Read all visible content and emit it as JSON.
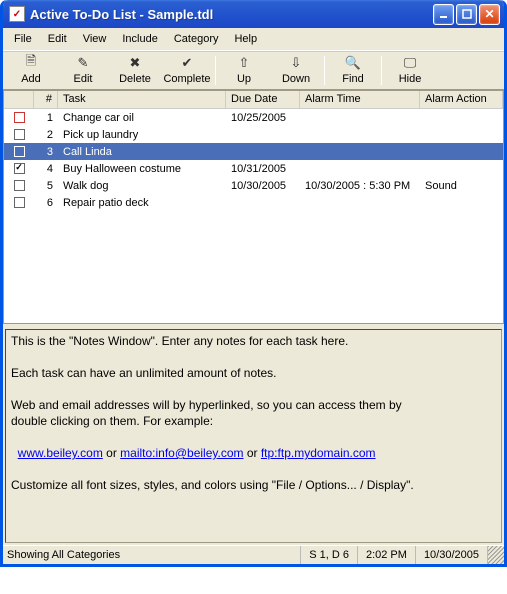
{
  "window": {
    "title": "Active To-Do List - Sample.tdl"
  },
  "menu": [
    "File",
    "Edit",
    "View",
    "Include",
    "Category",
    "Help"
  ],
  "toolbar": {
    "add": "Add",
    "edit": "Edit",
    "delete": "Delete",
    "complete": "Complete",
    "up": "Up",
    "down": "Down",
    "find": "Find",
    "hide": "Hide"
  },
  "columns": {
    "num": "#",
    "task": "Task",
    "due": "Due Date",
    "alarm": "Alarm Time",
    "action": "Alarm Action"
  },
  "tasks": [
    {
      "n": "1",
      "name": "Change car oil",
      "due": "10/25/2005",
      "alarm": "",
      "action": "",
      "checked": false,
      "red": true
    },
    {
      "n": "2",
      "name": "Pick up laundry",
      "due": "",
      "alarm": "",
      "action": "",
      "checked": false,
      "red": false
    },
    {
      "n": "3",
      "name": "Call Linda",
      "due": "",
      "alarm": "",
      "action": "",
      "checked": false,
      "red": false,
      "selected": true
    },
    {
      "n": "4",
      "name": "Buy Halloween costume",
      "due": "10/31/2005",
      "alarm": "",
      "action": "",
      "checked": true,
      "red": false
    },
    {
      "n": "5",
      "name": "Walk dog",
      "due": "10/30/2005",
      "alarm": "10/30/2005 : 5:30 PM",
      "action": "Sound",
      "checked": false,
      "red": false
    },
    {
      "n": "6",
      "name": "Repair patio deck",
      "due": "",
      "alarm": "",
      "action": "",
      "checked": false,
      "red": false
    }
  ],
  "notes": {
    "line1": "This is the \"Notes Window\".  Enter any notes for each task here.",
    "line2": "Each task can have an unlimited amount of notes.",
    "line3a": "Web and email addresses will by hyperlinked, so you can access them by",
    "line3b": "double clicking on them.  For example:",
    "link1": "www.beiley.com",
    "sep1": " or ",
    "link2": "mailto:info@beiley.com",
    "sep2": " or ",
    "link3": "ftp:ftp.mydomain.com",
    "line4": "Customize all font sizes, styles, and colors using \"File / Options... / Display\"."
  },
  "status": {
    "left": "Showing All Categories",
    "count": "S 1, D 6",
    "time": "2:02 PM",
    "date": "10/30/2005"
  }
}
